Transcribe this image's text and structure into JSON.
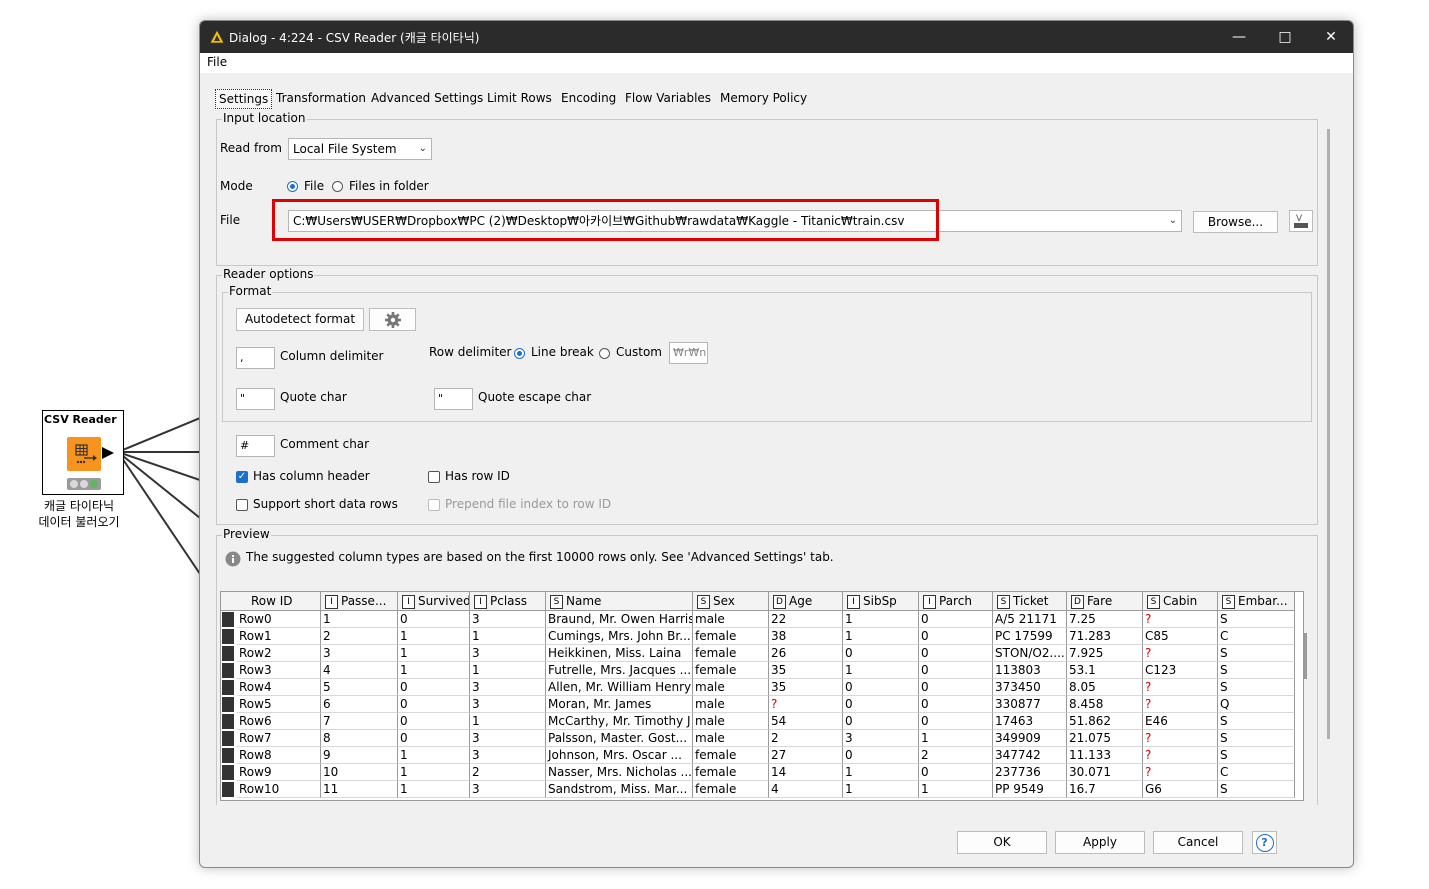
{
  "canvas": {
    "node_title": "CSV Reader",
    "node_label_line1": "캐글 타이타닉",
    "node_label_line2": "데이터 불러오기"
  },
  "dialog": {
    "title": "Dialog - 4:224 - CSV Reader (캐글 타이타닉)",
    "menu_file": "File",
    "tabs": [
      "Settings",
      "Transformation",
      "Advanced Settings",
      "Limit Rows",
      "Encoding",
      "Flow Variables",
      "Memory Policy"
    ],
    "input_location": {
      "legend": "Input location",
      "read_from_label": "Read from",
      "read_from_value": "Local File System",
      "mode_label": "Mode",
      "mode_file": "File",
      "mode_folder": "Files in folder",
      "file_label": "File",
      "file_path": "C:₩Users₩USER₩Dropbox₩PC (2)₩Desktop₩아카이브₩Github₩rawdata₩Kaggle - Titanic₩train.csv",
      "browse_label": "Browse..."
    },
    "reader_options": {
      "legend": "Reader options",
      "format_legend": "Format",
      "autodetect_label": "Autodetect format",
      "column_delimiter_value": ",",
      "column_delimiter_label": "Column delimiter",
      "row_delimiter_label": "Row delimiter",
      "row_delim_line_break": "Line break",
      "row_delim_custom": "Custom",
      "row_delim_custom_value": "₩r₩n",
      "quote_char_value": "\"",
      "quote_char_label": "Quote char",
      "quote_escape_value": "\"",
      "quote_escape_label": "Quote escape char",
      "comment_char_value": "#",
      "comment_char_label": "Comment char",
      "has_column_header": "Has column header",
      "has_row_id": "Has row ID",
      "support_short_rows": "Support short data rows",
      "prepend_file_index": "Prepend file index to row ID"
    },
    "preview": {
      "legend": "Preview",
      "info_text": "The suggested column types are based on the first 10000 rows only. See 'Advanced Settings' tab.",
      "columns": [
        {
          "type": "",
          "name": "Row ID"
        },
        {
          "type": "I",
          "name": "Passe..."
        },
        {
          "type": "I",
          "name": "Survived"
        },
        {
          "type": "I",
          "name": "Pclass"
        },
        {
          "type": "S",
          "name": "Name"
        },
        {
          "type": "S",
          "name": "Sex"
        },
        {
          "type": "D",
          "name": "Age"
        },
        {
          "type": "I",
          "name": "SibSp"
        },
        {
          "type": "I",
          "name": "Parch"
        },
        {
          "type": "S",
          "name": "Ticket"
        },
        {
          "type": "D",
          "name": "Fare"
        },
        {
          "type": "S",
          "name": "Cabin"
        },
        {
          "type": "S",
          "name": "Embar..."
        }
      ],
      "rows": [
        [
          "Row0",
          "1",
          "0",
          "3",
          "Braund, Mr. Owen Harris",
          "male",
          "22",
          "1",
          "0",
          "A/5 21171",
          "7.25",
          "?",
          "S"
        ],
        [
          "Row1",
          "2",
          "1",
          "1",
          "Cumings, Mrs. John Br...",
          "female",
          "38",
          "1",
          "0",
          "PC 17599",
          "71.283",
          "C85",
          "C"
        ],
        [
          "Row2",
          "3",
          "1",
          "3",
          "Heikkinen, Miss. Laina",
          "female",
          "26",
          "0",
          "0",
          "STON/O2....",
          "7.925",
          "?",
          "S"
        ],
        [
          "Row3",
          "4",
          "1",
          "1",
          "Futrelle, Mrs. Jacques ...",
          "female",
          "35",
          "1",
          "0",
          "113803",
          "53.1",
          "C123",
          "S"
        ],
        [
          "Row4",
          "5",
          "0",
          "3",
          "Allen, Mr. William Henry",
          "male",
          "35",
          "0",
          "0",
          "373450",
          "8.05",
          "?",
          "S"
        ],
        [
          "Row5",
          "6",
          "0",
          "3",
          "Moran, Mr. James",
          "male",
          "?",
          "0",
          "0",
          "330877",
          "8.458",
          "?",
          "Q"
        ],
        [
          "Row6",
          "7",
          "0",
          "1",
          "McCarthy, Mr. Timothy J",
          "male",
          "54",
          "0",
          "0",
          "17463",
          "51.862",
          "E46",
          "S"
        ],
        [
          "Row7",
          "8",
          "0",
          "3",
          "Palsson, Master. Gost...",
          "male",
          "2",
          "3",
          "1",
          "349909",
          "21.075",
          "?",
          "S"
        ],
        [
          "Row8",
          "9",
          "1",
          "3",
          "Johnson, Mrs. Oscar ...",
          "female",
          "27",
          "0",
          "2",
          "347742",
          "11.133",
          "?",
          "S"
        ],
        [
          "Row9",
          "10",
          "1",
          "2",
          "Nasser, Mrs. Nicholas ...",
          "female",
          "14",
          "1",
          "0",
          "237736",
          "30.071",
          "?",
          "C"
        ],
        [
          "Row10",
          "11",
          "1",
          "3",
          "Sandstrom, Miss. Mar...",
          "female",
          "4",
          "1",
          "1",
          "PP 9549",
          "16.7",
          "G6",
          "S"
        ]
      ]
    },
    "buttons": {
      "ok": "OK",
      "apply": "Apply",
      "cancel": "Cancel",
      "help": "?"
    }
  }
}
